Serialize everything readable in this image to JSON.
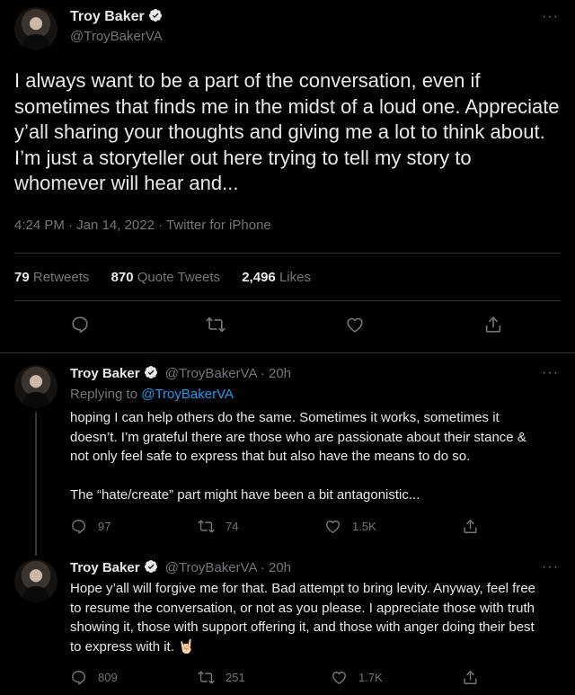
{
  "main": {
    "author_name": "Troy Baker",
    "handle": "@TroyBakerVA",
    "text": "I always want to be a part of the conversation, even if sometimes that finds me in the midst of a loud one. Appreciate y’all sharing your thoughts and giving me a lot to think about. I’m just a storyteller out here trying to tell my story to whomever will hear and...",
    "time": "4:24 PM",
    "date": "Jan 14, 2022",
    "source": "Twitter for iPhone",
    "stats": {
      "retweets": "79",
      "retweets_label": "Retweets",
      "quotes": "870",
      "quotes_label": "Quote Tweets",
      "likes": "2,496",
      "likes_label": "Likes"
    }
  },
  "replies": [
    {
      "author_name": "Troy Baker",
      "handle": "@TroyBakerVA",
      "age": "20h",
      "replying_prefix": "Replying to",
      "replying_to": "@TroyBakerVA",
      "paragraph1": "hoping I can help others do the same. Sometimes it works, sometimes it doesn’t. I’m grateful there are those who are passionate about their stance & not only feel safe to express that but also have the means to do so.",
      "paragraph2": "The “hate/create” part might have been a bit antagonistic...",
      "reply_count": "97",
      "retweet_count": "74",
      "like_count": "1.5K"
    },
    {
      "author_name": "Troy Baker",
      "handle": "@TroyBakerVA",
      "age": "20h",
      "paragraph1": "Hope y’all will forgive me for that. Bad attempt to bring levity. Anyway, feel free to resume the conversation, or not as you please. I appreciate those with truth showing it, those with support offering it, and those with anger doing their best to express with it. 🤘🏻",
      "reply_count": "809",
      "retweet_count": "251",
      "like_count": "1.7K"
    }
  ],
  "colors": {
    "background": "#000000",
    "text": "#e7e9ea",
    "secondary": "#71767b",
    "accent": "#1d9bf0",
    "divider": "#2f3336"
  },
  "icons": [
    "verified-badge-icon",
    "more-options-icon",
    "reply-icon",
    "retweet-icon",
    "like-icon",
    "share-icon"
  ]
}
